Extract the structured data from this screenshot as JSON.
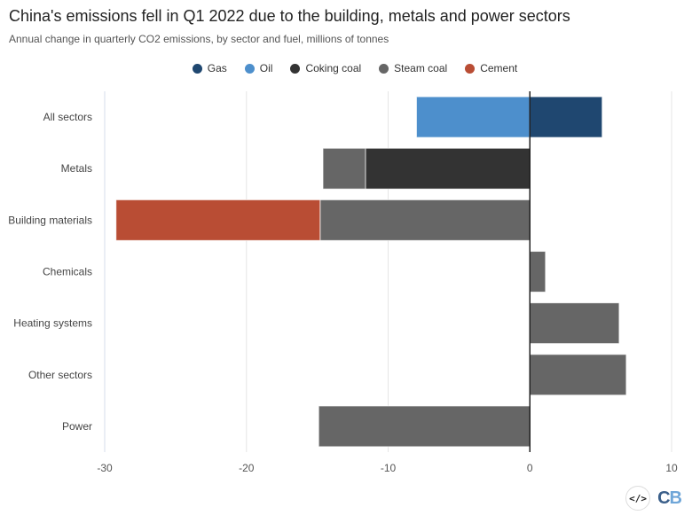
{
  "header": {
    "title": "China's emissions fell in Q1 2022 due to the building, metals and power sectors",
    "subtitle": "Annual change in quarterly CO2 emissions, by sector and fuel, millions of tonnes"
  },
  "footer": {
    "embed_icon": "</>",
    "logo_c": "C",
    "logo_b": "B"
  },
  "chart_data": {
    "type": "bar",
    "orientation": "horizontal",
    "stacked": true,
    "title": "China's emissions fell in Q1 2022 due to the building, metals and power sectors",
    "subtitle": "Annual change in quarterly CO2 emissions, by sector and fuel, millions of tonnes",
    "xlabel": "",
    "ylabel": "",
    "xlim": [
      -30,
      10
    ],
    "xticks": [
      -30,
      -20,
      -10,
      0,
      10
    ],
    "grid": true,
    "legend_position": "top-center",
    "categories": [
      "All sectors",
      "Metals",
      "Building materials",
      "Chemicals",
      "Heating systems",
      "Other sectors",
      "Power"
    ],
    "series": [
      {
        "name": "Gas",
        "color": "#1f4770",
        "values": [
          5.1,
          0,
          0,
          0,
          0,
          0,
          0
        ]
      },
      {
        "name": "Oil",
        "color": "#4d8fcc",
        "values": [
          -8.0,
          0,
          0,
          0,
          0,
          0,
          0
        ]
      },
      {
        "name": "Coking coal",
        "color": "#333333",
        "values": [
          0,
          -11.6,
          0,
          0,
          0,
          0,
          0
        ]
      },
      {
        "name": "Steam coal",
        "color": "#666666",
        "values": [
          0,
          -3.0,
          -14.8,
          1.1,
          6.3,
          6.8,
          -14.9
        ]
      },
      {
        "name": "Cement",
        "color": "#b94d34",
        "values": [
          0,
          0,
          -14.4,
          0,
          0,
          0,
          0
        ]
      }
    ]
  }
}
